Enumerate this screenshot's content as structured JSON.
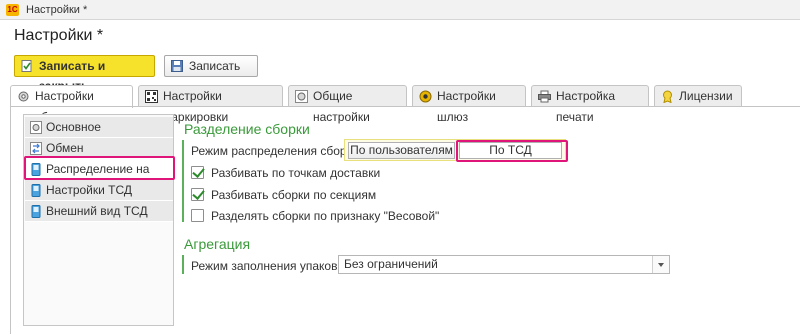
{
  "window": {
    "title": "Настройки *",
    "logo_text": "1С"
  },
  "form": {
    "title": "Настройки *"
  },
  "toolbar": {
    "save_close_label": "Записать и закрыть",
    "save_label": "Записать"
  },
  "tabs": [
    {
      "label": "Настройки сборки",
      "icon": "gear-icon"
    },
    {
      "label": "Настройки маркировки",
      "icon": "qr-code-icon"
    },
    {
      "label": "Общие настройки",
      "icon": "gear-icon"
    },
    {
      "label": "Настройки шлюз",
      "icon": "gateway-icon"
    },
    {
      "label": "Настройка печати",
      "icon": "printer-icon"
    },
    {
      "label": "Лицензии",
      "icon": "license-icon"
    }
  ],
  "sidebar": {
    "items": [
      {
        "label": "Основное",
        "icon": "gear-icon"
      },
      {
        "label": "Обмен",
        "icon": "exchange-icon"
      },
      {
        "label": "Распределение на ТСД",
        "icon": "mobile-device-icon"
      },
      {
        "label": "Настройки ТСД",
        "icon": "mobile-device-icon"
      },
      {
        "label": "Внешний вид ТСД",
        "icon": "mobile-device-icon"
      }
    ]
  },
  "assembly": {
    "section_title": "Разделение сборки",
    "mode_label": "Режим распределения сборок:",
    "mode_options": [
      "По пользователям",
      "По ТСД"
    ],
    "mode_selected": "По ТСД",
    "checkboxes": [
      {
        "label": "Разбивать по точкам доставки",
        "checked": true
      },
      {
        "label": "Разбивать сборки по секциям",
        "checked": true
      },
      {
        "label": "Разделять сборки по признаку \"Весовой\"",
        "checked": false
      }
    ]
  },
  "aggregation": {
    "section_title": "Агрегация",
    "pack_mode_label": "Режим заполнения упаковки:",
    "pack_mode_value": "Без ограничений"
  },
  "colors": {
    "accent_green": "#3a9a3a",
    "highlight": "#e0157a",
    "primary_button": "#f6e12b"
  }
}
